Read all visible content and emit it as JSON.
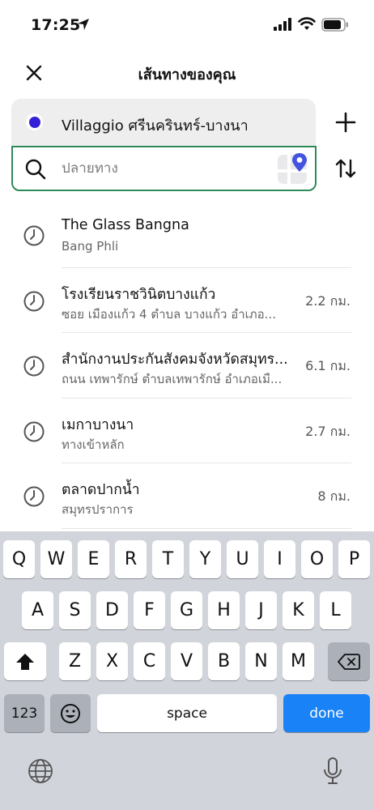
{
  "status": {
    "time": "17:25"
  },
  "header": {
    "title": "เส้นทางของคุณ"
  },
  "origin": {
    "label": "Villaggio ศรีนครินทร์-บางนา"
  },
  "destination": {
    "placeholder": "ปลายทาง",
    "value": ""
  },
  "results": [
    {
      "title": "The Glass Bangna",
      "subtitle": "Bang Phli",
      "distance": ""
    },
    {
      "title": "โรงเรียนราชวินิตบางแก้ว",
      "subtitle": "ซอย เมืองแก้ว 4 ตำบล บางแก้ว อำเภอ...",
      "distance": "2.2 กม."
    },
    {
      "title": "สำนักงานประกันสังคมจังหวัดสมุทร...",
      "subtitle": "ถนน เทพารักษ์ ตำบลเทพารักษ์ อำเภอเมื...",
      "distance": "6.1 กม."
    },
    {
      "title": "เมกาบางนา",
      "subtitle": "ทางเข้าหลัก",
      "distance": "2.7 กม."
    },
    {
      "title": "ตลาดปากน้ำ",
      "subtitle": "สมุทรปราการ",
      "distance": "8 กม."
    }
  ],
  "keyboard": {
    "row1": [
      "Q",
      "W",
      "E",
      "R",
      "T",
      "Y",
      "U",
      "I",
      "O",
      "P"
    ],
    "row2": [
      "A",
      "S",
      "D",
      "F",
      "G",
      "H",
      "J",
      "K",
      "L"
    ],
    "row3": [
      "Z",
      "X",
      "C",
      "V",
      "B",
      "N",
      "M"
    ],
    "numbers_label": "123",
    "space_label": "space",
    "done_label": "done"
  },
  "colors": {
    "accent_green": "#2e8b57",
    "origin_dot": "#3520d8",
    "done_blue": "#1a82f7"
  }
}
